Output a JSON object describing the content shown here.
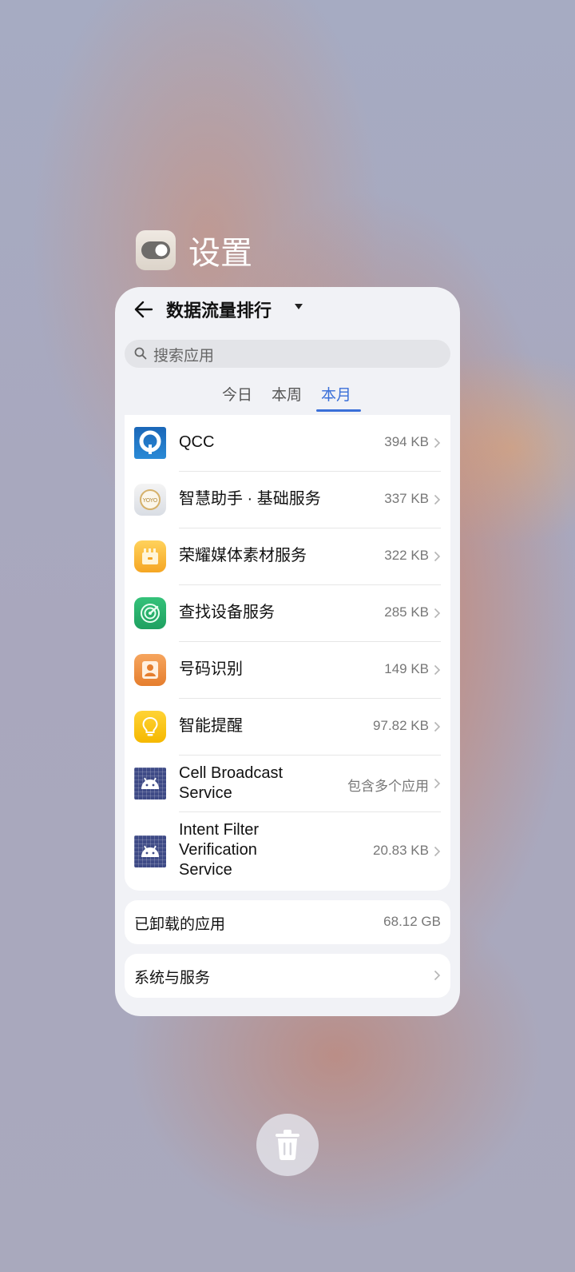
{
  "app": {
    "title": "设置",
    "icon": "settings-toggle-icon"
  },
  "page": {
    "title": "数据流量排行"
  },
  "search": {
    "placeholder": "搜索应用"
  },
  "tabs": [
    {
      "label": "今日",
      "active": false
    },
    {
      "label": "本周",
      "active": false
    },
    {
      "label": "本月",
      "active": true
    }
  ],
  "apps": [
    {
      "name": "QCC",
      "value": "394 KB",
      "icon": "qcc-icon"
    },
    {
      "name": "智慧助手 · 基础服务",
      "value": "337 KB",
      "icon": "yoyo-assistant-icon"
    },
    {
      "name": "荣耀媒体素材服务",
      "value": "322 KB",
      "icon": "media-assets-icon"
    },
    {
      "name": "查找设备服务",
      "value": "285 KB",
      "icon": "find-device-icon"
    },
    {
      "name": "号码识别",
      "value": "149 KB",
      "icon": "number-id-icon"
    },
    {
      "name": "智能提醒",
      "value": "97.82 KB",
      "icon": "smart-reminder-icon"
    },
    {
      "name_lines": [
        "Cell Broadcast",
        "Service"
      ],
      "value": "包含多个应用",
      "icon": "android-icon"
    },
    {
      "name_lines": [
        "Intent Filter",
        "Verification",
        "Service"
      ],
      "value": "20.83 KB",
      "icon": "android-icon"
    }
  ],
  "uninstalled": {
    "label": "已卸载的应用",
    "value": "68.12 GB"
  },
  "system": {
    "label": "系统与服务"
  },
  "colors": {
    "accent": "#3a6fd8",
    "card_bg": "#f1f2f6"
  }
}
